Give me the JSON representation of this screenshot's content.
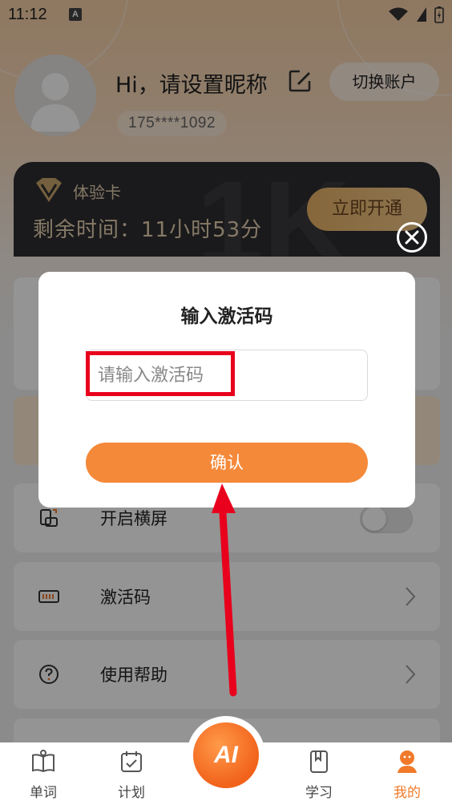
{
  "status_bar": {
    "time": "11:12",
    "app_badge": "A"
  },
  "header": {
    "greeting": "Hi，请设置昵称",
    "switch_account": "切换账户",
    "phone": "175****1092"
  },
  "vip_card": {
    "label": "体验卡",
    "remaining": "剩余时间：11小时53分",
    "activate_button": "立即开通"
  },
  "menu": {
    "items": [
      {
        "label": "开启横屏",
        "icon": "rotate-screen-icon",
        "control": "toggle"
      },
      {
        "label": "激活码",
        "icon": "barcode-icon",
        "control": "chevron"
      },
      {
        "label": "使用帮助",
        "icon": "help-circle-icon",
        "control": "chevron"
      }
    ],
    "landscape_enabled": false
  },
  "dialog": {
    "title": "输入激活码",
    "input_placeholder": "请输入激活码",
    "input_value": "",
    "confirm_label": "确认"
  },
  "tab_bar": {
    "tabs": [
      {
        "label": "单词",
        "icon": "book-icon"
      },
      {
        "label": "计划",
        "icon": "calendar-icon"
      },
      {
        "label": "学习",
        "icon": "bookmark-icon"
      },
      {
        "label": "我的",
        "icon": "profile-icon",
        "active": true
      }
    ],
    "center_button": "AI"
  },
  "colors": {
    "accent": "#f5893a",
    "active_tab": "#f07a2a",
    "vip_gold": "#e6d0b0",
    "highlight": "#e8001c"
  }
}
